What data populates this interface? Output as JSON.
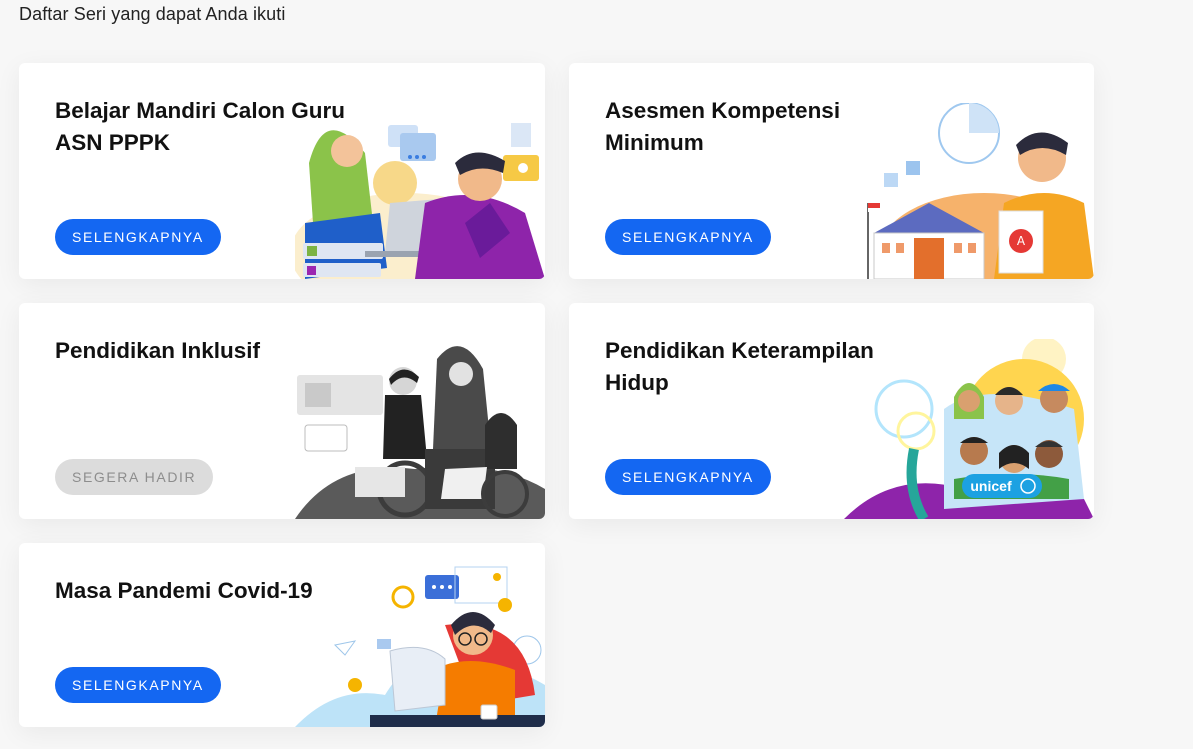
{
  "page": {
    "heading": "Daftar Seri yang dapat Anda ikuti"
  },
  "cards": [
    {
      "title": "Belajar Mandiri Calon Guru ASN PPPK",
      "button": "SELENGKAPNYA",
      "status": "active"
    },
    {
      "title": "Asesmen Kompetensi Minimum",
      "button": "SELENGKAPNYA",
      "status": "active"
    },
    {
      "title": "Pendidikan Inklusif",
      "button": "SEGERA HADIR",
      "status": "disabled"
    },
    {
      "title": "Pendidikan Keterampilan Hidup",
      "button": "SELENGKAPNYA",
      "status": "active",
      "logo_text": "unicef"
    },
    {
      "title": "Masa Pandemi Covid-19",
      "button": "SELENGKAPNYA",
      "status": "active"
    }
  ],
  "colors": {
    "primary_button": "#1467f2",
    "disabled_button": "#dcdcdc",
    "card_bg": "#ffffff",
    "page_bg": "#f7f7f7"
  },
  "illustrations": [
    "teachers-with-laptops-illustration",
    "school-building-certificate-illustration",
    "inclusive-wheelchair-grayscale-illustration",
    "diverse-children-unicef-illustration",
    "remote-learning-computer-illustration"
  ]
}
